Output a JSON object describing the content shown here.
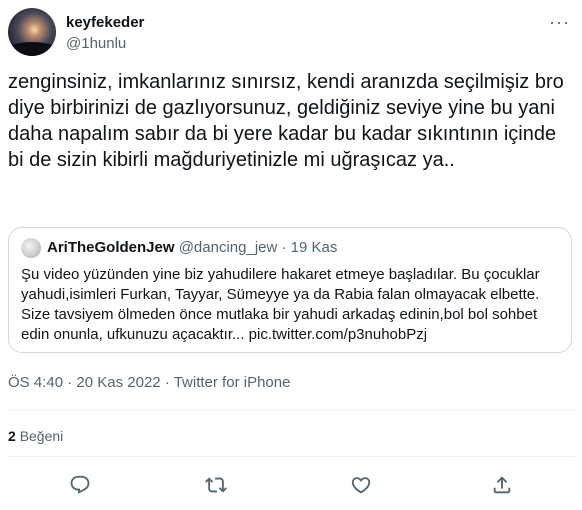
{
  "author": {
    "display_name": "keyfekeder",
    "handle": "@1hunlu"
  },
  "tweet": {
    "text": "zenginsiniz, imkanlarınız sınırsız, kendi aranızda seçilmişiz bro diye birbirinizi de gazlıyorsunuz, geldiğiniz seviye yine bu yani daha napalım sabır da bi yere kadar bu kadar sıkıntının içinde bi de sizin kibirli mağduriyetinizle mi uğraşıcaz ya.."
  },
  "quote": {
    "display_name": "AriTheGoldenJew",
    "handle": "@dancing_jew",
    "separator": "·",
    "date": "19 Kas",
    "text": "Şu video yüzünden yine biz yahudilere hakaret etmeye başladılar. Bu çocuklar yahudi,isimleri Furkan, Tayyar, Sümeyye ya da Rabia falan olmayacak elbette. Size tavsiyem ölmeden önce mutlaka bir yahudi arkadaş edinin,bol bol sohbet edin onunla, ufkunuzu açacaktır... pic.twitter.com/p3nuhobPzj"
  },
  "meta": {
    "time": "ÖS 4:40",
    "separator": "·",
    "date": "20 Kas 2022",
    "source": "Twitter for iPhone"
  },
  "likes": {
    "count": "2",
    "label": "Beğeni"
  },
  "icons": {
    "more": "more-dots-icon",
    "reply": "reply-icon",
    "retweet": "retweet-icon",
    "like": "heart-icon",
    "share": "share-icon"
  },
  "colors": {
    "text": "#0f1419",
    "secondary": "#536471",
    "border": "#cfd9de",
    "divider": "#eff3f4"
  }
}
